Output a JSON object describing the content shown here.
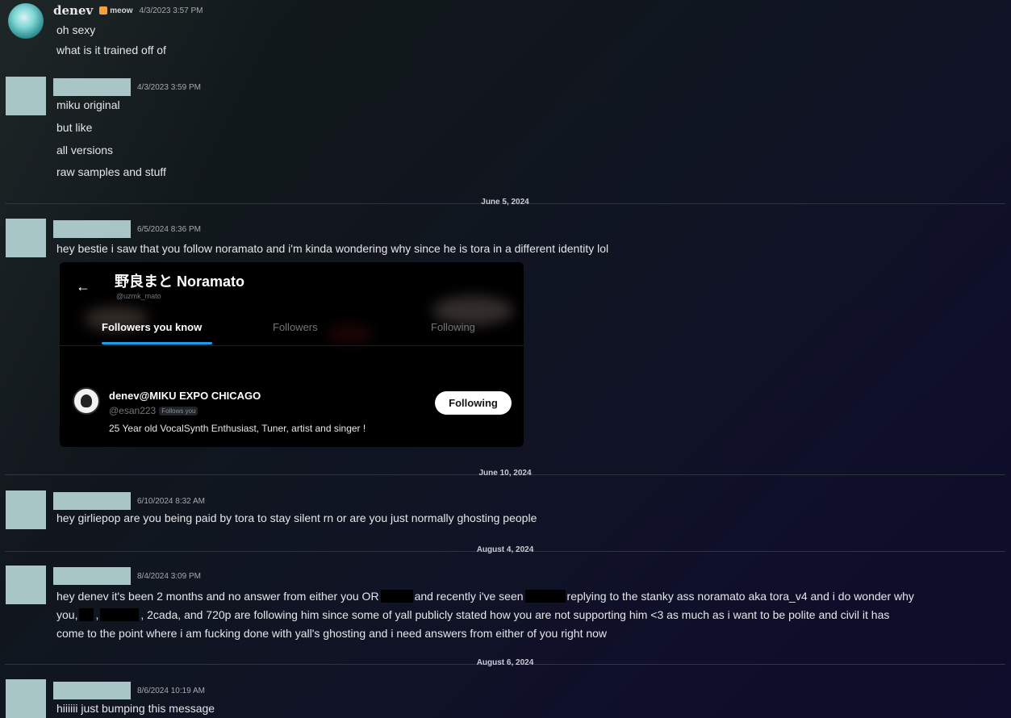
{
  "messages": [
    {
      "username": "denev",
      "tag": "meow",
      "timestamp": "4/3/2023 3:57 PM",
      "lines": [
        "oh sexy",
        "what is it trained off of"
      ]
    },
    {
      "timestamp": "4/3/2023 3:59 PM",
      "lines": [
        "miku original",
        "but like",
        "all versions",
        "raw samples and stuff"
      ]
    },
    {
      "timestamp": "6/5/2024 8:36 PM",
      "lines": [
        "hey bestie i saw that you follow noramato and i'm kinda wondering why since he is tora in a different identity lol"
      ]
    },
    {
      "timestamp": "6/10/2024 8:32 AM",
      "lines": [
        "hey girliepop are you being paid by tora to stay silent rn or are you just normally ghosting people"
      ]
    },
    {
      "timestamp": "8/4/2024 3:09 PM",
      "line1": {
        "a": "hey denev it's been 2 months and no answer from either you OR",
        "b": "and recently i've seen",
        "c": "replying to the stanky ass noramato aka tora_v4 and i do wonder why"
      },
      "line2": {
        "a": "you,",
        "b": ",",
        "c": ", 2cada, and 720p are following him since some of yall publicly stated how you are not supporting him <3 as much as i want to be polite and civil it has"
      },
      "line3": "come to the point where i am fucking done with yall's ghosting and i need answers from either of you right now"
    },
    {
      "timestamp": "8/6/2024 10:19 AM",
      "lines": [
        "hiiiiii just bumping this message"
      ]
    }
  ],
  "dividers": [
    "June 5, 2024",
    "June 10, 2024",
    "August 4, 2024",
    "August 6, 2024"
  ],
  "embed": {
    "back_icon": "←",
    "profile_name": "野良まと Noramato",
    "profile_handle": "@uzmk_mato",
    "tabs": [
      "Followers you know",
      "Followers",
      "Following"
    ],
    "user": {
      "name": "denev@MIKU EXPO CHICAGO",
      "handle": "@esan223",
      "badge": "Follows you",
      "bio": "25 Year old VocalSynth Enthusiast, Tuner, artist and singer !",
      "button": "Following"
    }
  },
  "colors": {
    "avatar_placeholder": "#a9c6c7",
    "accent_blue": "#1d9bf0",
    "tag_orange": "#f2a13e"
  }
}
